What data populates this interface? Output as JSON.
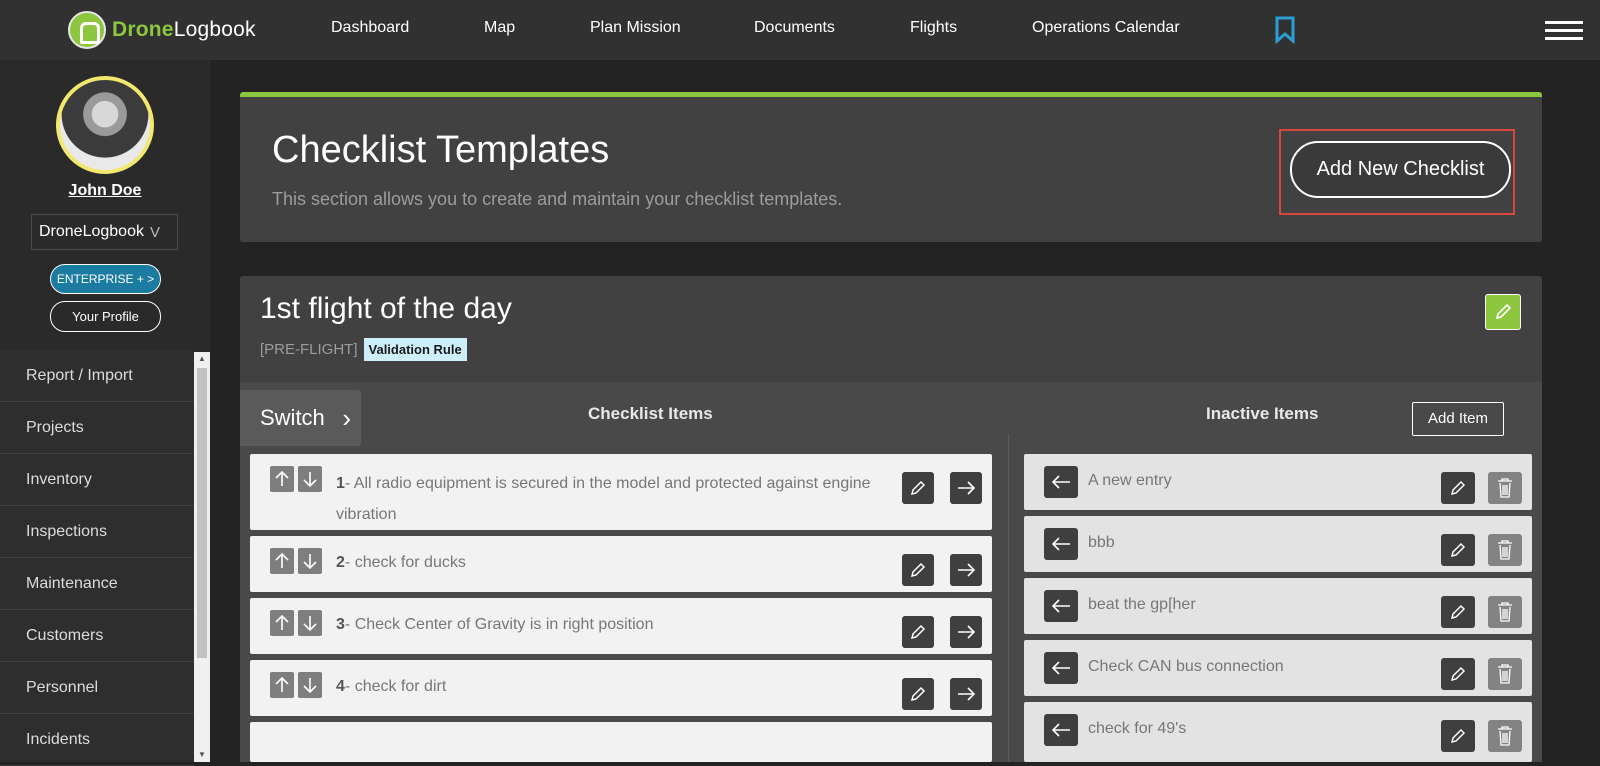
{
  "nav": {
    "logo_part1": "Drone",
    "logo_part2": "Logbook",
    "links": [
      "Dashboard",
      "Map",
      "Plan Mission",
      "Documents",
      "Flights",
      "Operations Calendar"
    ]
  },
  "sidebar": {
    "username": "John Doe",
    "org_select": "DroneLogbook",
    "enterprise_label": "ENTERPRISE + >",
    "profile_label": "Your Profile",
    "menu": [
      "Report / Import",
      "Projects",
      "Inventory",
      "Inspections",
      "Maintenance",
      "Customers",
      "Personnel",
      "Incidents"
    ]
  },
  "header": {
    "title": "Checklist Templates",
    "description": "This section allows you to create and maintain your checklist templates.",
    "add_button": "Add New Checklist"
  },
  "checklist": {
    "title": "1st flight of the day",
    "tag": "[PRE-FLIGHT]",
    "validation": "Validation Rule",
    "switch_label": "Switch",
    "items_heading": "Checklist Items",
    "inactive_heading": "Inactive Items",
    "add_item_label": "Add Item",
    "items": [
      {
        "num": "1",
        "text": "All radio equipment is secured in the model and protected against engine vibration"
      },
      {
        "num": "2",
        "text": "check for ducks"
      },
      {
        "num": "3",
        "text": "Check Center of Gravity is in right position"
      },
      {
        "num": "4",
        "text": "check for dirt"
      }
    ],
    "inactive_items": [
      "A new entry",
      "bbb",
      "beat the gp[her",
      "Check CAN bus connection",
      "check for 49's"
    ]
  },
  "colors": {
    "accent_green": "#8dc63f",
    "enterprise_blue": "#1b7ba0",
    "highlight_red": "#d9473b",
    "bookmark_blue": "#2a9fd6"
  }
}
